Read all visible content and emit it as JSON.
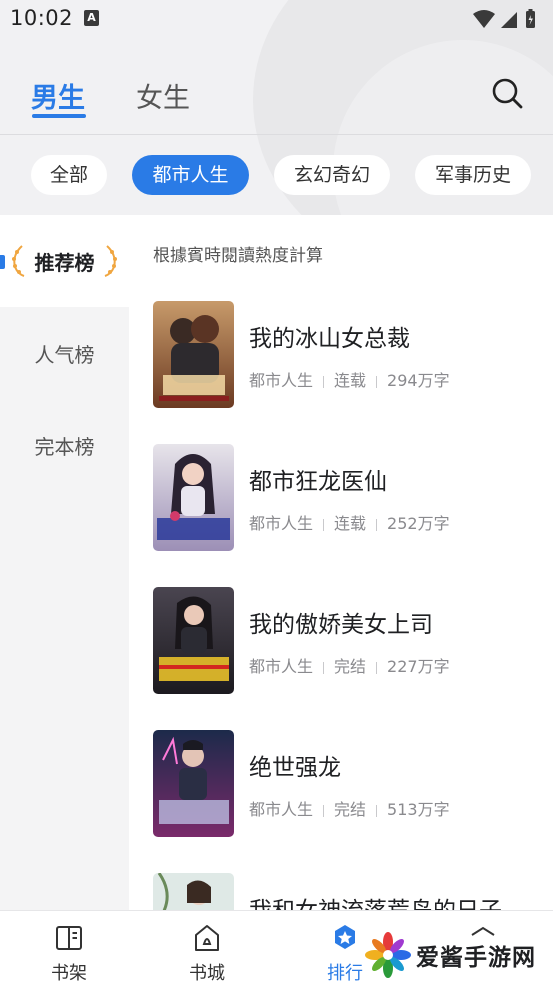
{
  "status_bar": {
    "time": "10:02",
    "notification_icon": "A"
  },
  "header": {
    "tabs": [
      {
        "label": "男生",
        "active": true
      },
      {
        "label": "女生",
        "active": false
      }
    ],
    "search_icon": "search-icon"
  },
  "chips": [
    {
      "label": "全部",
      "selected": false
    },
    {
      "label": "都市人生",
      "selected": true
    },
    {
      "label": "玄幻奇幻",
      "selected": false
    },
    {
      "label": "军事历史",
      "selected": false
    }
  ],
  "sidebar": {
    "items": [
      {
        "label": "推荐榜",
        "active": true
      },
      {
        "label": "人气榜",
        "active": false
      },
      {
        "label": "完本榜",
        "active": false
      }
    ]
  },
  "main": {
    "note": "根據賓時閱讀熱度計算",
    "books": [
      {
        "title": "我的冰山女总裁",
        "category": "都市人生",
        "status": "连载",
        "words": "294万字"
      },
      {
        "title": "都市狂龙医仙",
        "category": "都市人生",
        "status": "连载",
        "words": "252万字"
      },
      {
        "title": "我的傲娇美女上司",
        "category": "都市人生",
        "status": "完结",
        "words": "227万字"
      },
      {
        "title": "绝世强龙",
        "category": "都市人生",
        "status": "完结",
        "words": "513万字"
      },
      {
        "title": "我和女神流落荒岛的日子",
        "category": "",
        "status": "",
        "words": ""
      }
    ]
  },
  "bottom_nav": {
    "items": [
      {
        "label": "书架",
        "icon": "book-open-icon"
      },
      {
        "label": "书城",
        "icon": "home-icon"
      },
      {
        "label": "排行",
        "icon": "ranking-icon",
        "active": true
      },
      {
        "label": "",
        "icon": "profile-icon"
      }
    ]
  },
  "watermark": {
    "text": "爱酱手游网"
  },
  "colors": {
    "accent": "#2a7be6",
    "page_bg": "#f4f4f5",
    "meta_text": "#8a8a8e"
  }
}
